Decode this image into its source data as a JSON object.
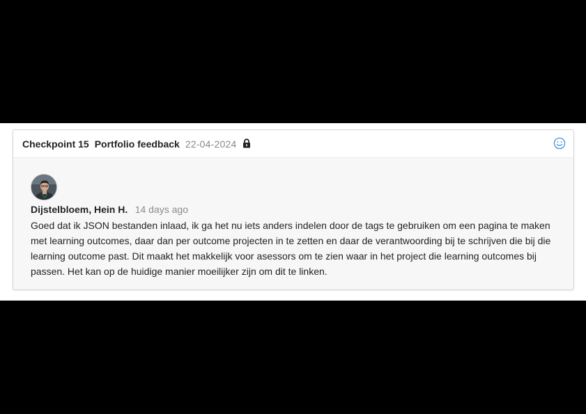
{
  "header": {
    "checkpoint": "Checkpoint 15",
    "title": "Portfolio feedback",
    "date": "22-04-2024",
    "lock_icon": "lock-icon",
    "reaction_icon": "smiley-icon"
  },
  "comment": {
    "author": "Dijstelbloem, Hein H.",
    "time": "14 days ago",
    "text": "Goed dat ik JSON bestanden inlaad, ik ga het nu iets anders indelen door de tags te gebruiken om een pagina te maken met learning outcomes, daar dan per outcome projecten in te zetten en daar de verantwoording bij te schrijven die bij die learning outcome past. Dit maakt het makkelijk voor asessors om te zien waar in het project die learning outcomes bij passen. Het kan op de huidige manier moeilijker zijn om dit te linken."
  },
  "colors": {
    "accent": "#4a8fd6",
    "text": "#222222",
    "muted": "#888888",
    "card_bg": "#f7f7f7"
  }
}
